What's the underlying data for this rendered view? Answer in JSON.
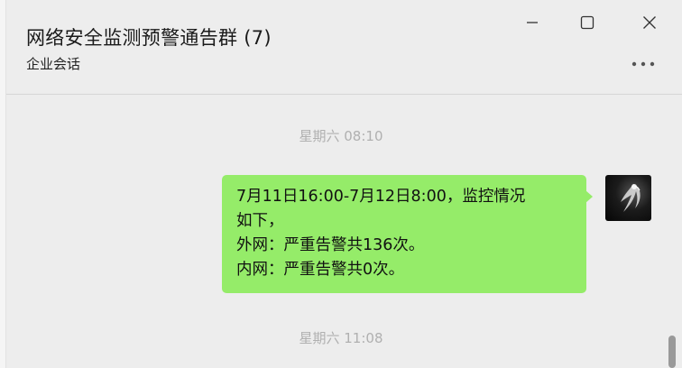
{
  "header": {
    "title": "网络安全监测预警通告群 (7)",
    "subtitle": "企业会话"
  },
  "window_controls": {
    "minimize_icon": "minimize-icon",
    "maximize_icon": "maximize-icon",
    "close_icon": "close-icon",
    "more_icon": "more-horizontal-icon"
  },
  "messages": {
    "timestamp_1": "星期六 08:10",
    "message_1": {
      "lines": [
        "7月11日16:00-7月12日8:00，监控情况",
        "如下，",
        "外网：严重告警共136次。",
        "内网：严重告警共0次。"
      ],
      "bubble_color": "#95ec69"
    },
    "timestamp_2": "星期六 11:08"
  },
  "colors": {
    "background": "#ededed",
    "bubble": "#95ec69",
    "timestamp": "#b0b0b0"
  }
}
